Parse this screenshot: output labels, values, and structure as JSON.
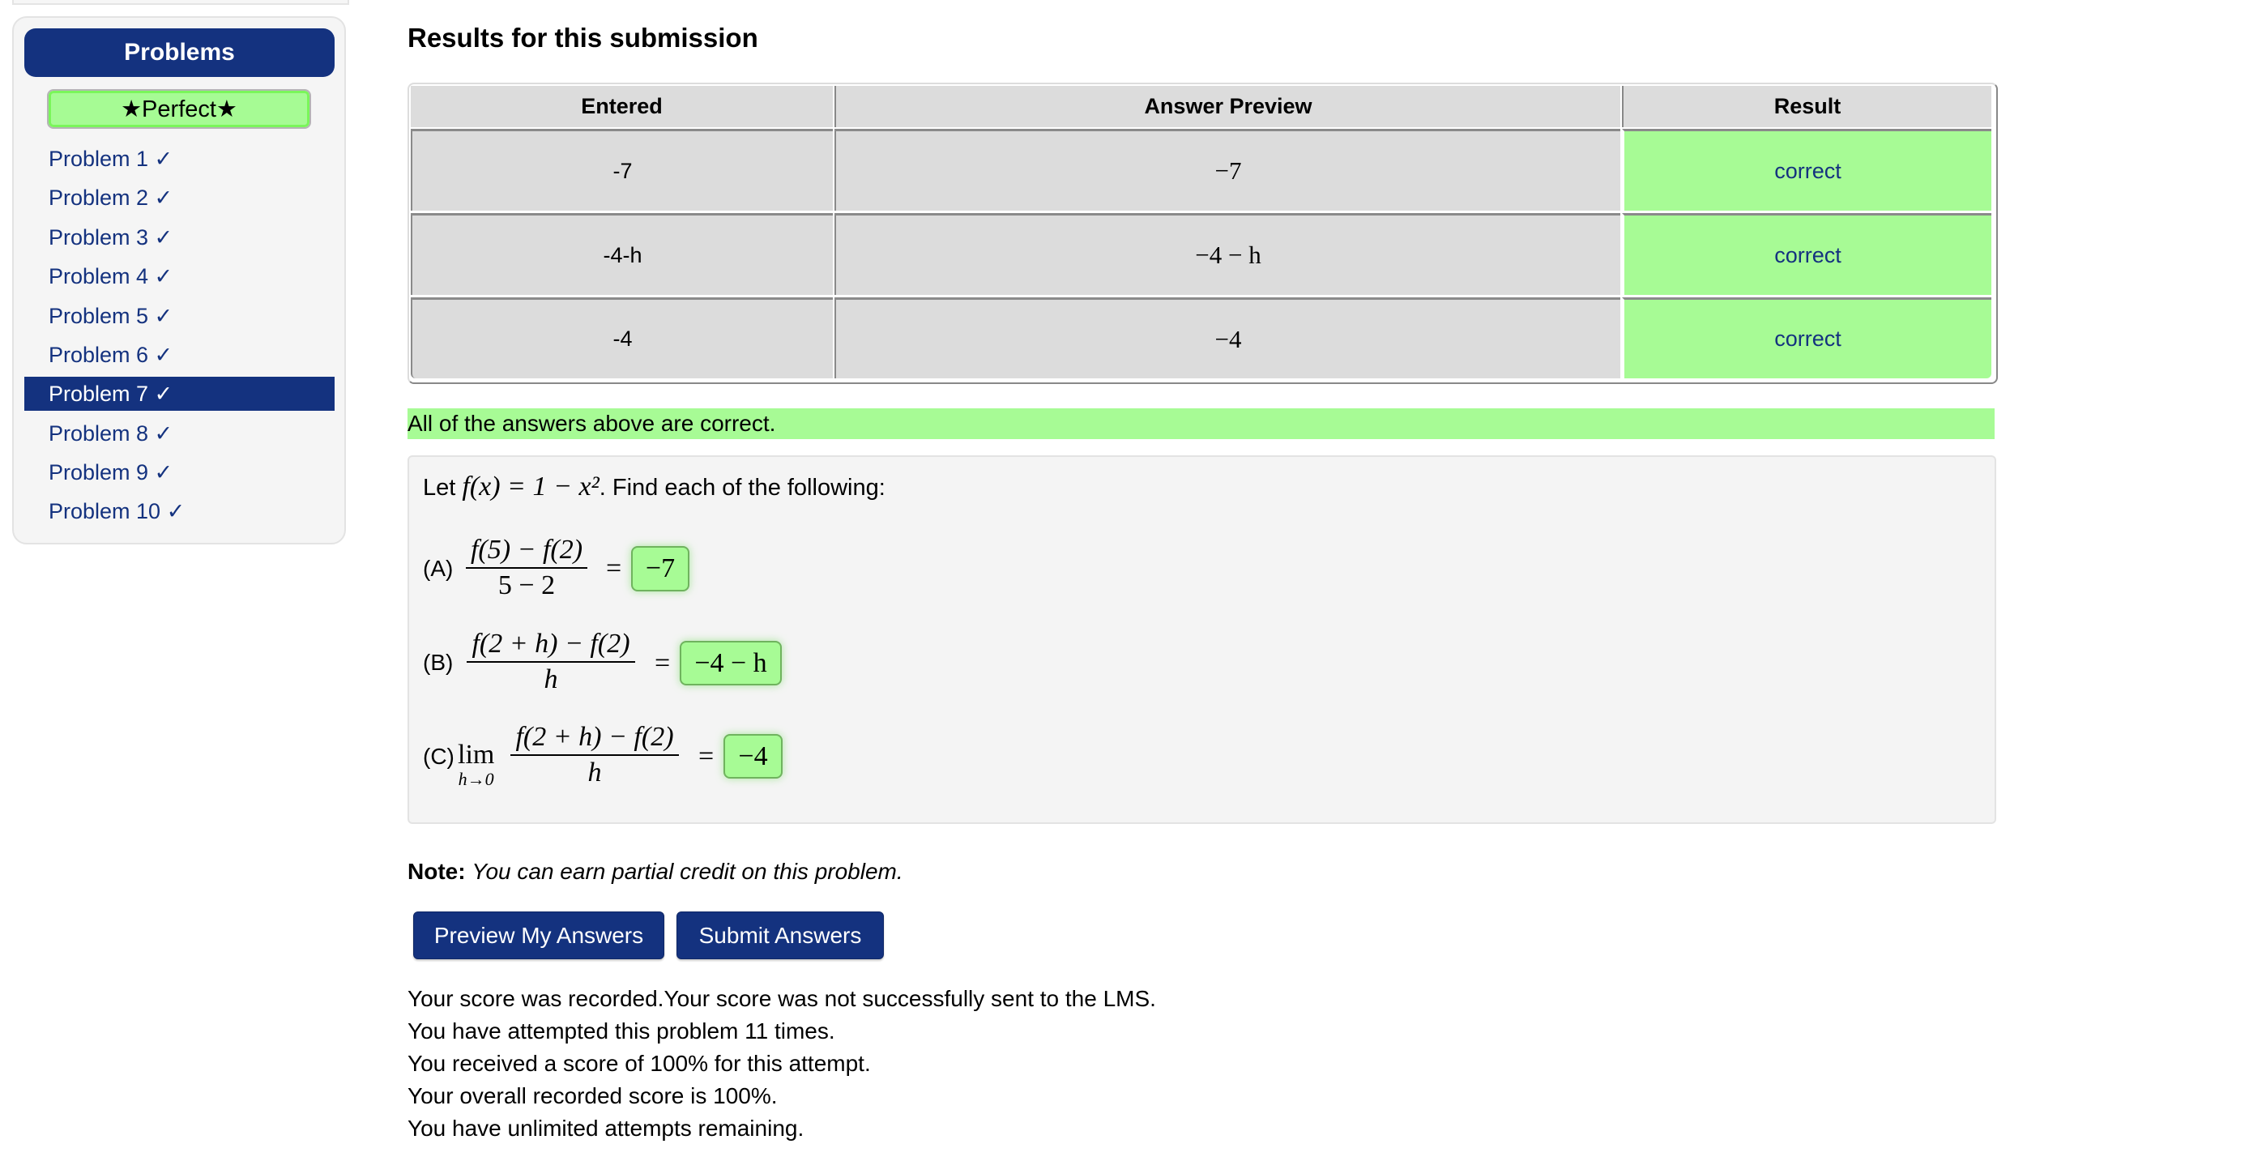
{
  "sidebar": {
    "title": "Problems",
    "status_badge": "★Perfect★",
    "items": [
      {
        "label": "Problem 1 ✓",
        "active": false
      },
      {
        "label": "Problem 2 ✓",
        "active": false
      },
      {
        "label": "Problem 3 ✓",
        "active": false
      },
      {
        "label": "Problem 4 ✓",
        "active": false
      },
      {
        "label": "Problem 5 ✓",
        "active": false
      },
      {
        "label": "Problem 6 ✓",
        "active": false
      },
      {
        "label": "Problem 7 ✓",
        "active": true
      },
      {
        "label": "Problem 8 ✓",
        "active": false
      },
      {
        "label": "Problem 9 ✓",
        "active": false
      },
      {
        "label": "Problem 10 ✓",
        "active": false
      }
    ]
  },
  "results": {
    "heading": "Results for this submission",
    "columns": [
      "Entered",
      "Answer Preview",
      "Result"
    ],
    "rows": [
      {
        "entered": "-7",
        "preview": "−7",
        "result": "correct"
      },
      {
        "entered": "-4-h",
        "preview": "−4 − h",
        "result": "correct"
      },
      {
        "entered": "-4",
        "preview": "−4",
        "result": "correct"
      }
    ],
    "summary": "All of the answers above are correct."
  },
  "problem": {
    "intro_prefix": "Let ",
    "intro_math": "f(x) = 1 − x²",
    "intro_suffix": ". Find each of the following:",
    "parts": [
      {
        "label": "(A)",
        "numerator": "f(5) − f(2)",
        "denominator": "5 − 2",
        "limit": null,
        "answer": "−7"
      },
      {
        "label": "(B)",
        "numerator": "f(2 + h) − f(2)",
        "denominator": "h",
        "limit": null,
        "answer": "−4 − h"
      },
      {
        "label": "(C)",
        "numerator": "f(2 + h) − f(2)",
        "denominator": "h",
        "limit": {
          "op": "lim",
          "sub": "h→0"
        },
        "answer": "−4"
      }
    ],
    "equals": "="
  },
  "note": {
    "label": "Note:",
    "text": "You can earn partial credit on this problem."
  },
  "buttons": {
    "preview": "Preview My Answers",
    "submit": "Submit Answers"
  },
  "score_messages": [
    "Your score was recorded.Your score was not successfully sent to the LMS.",
    "You have attempted this problem 11 times.",
    "You received a score of 100% for this attempt.",
    "Your overall recorded score is 100%.",
    "You have unlimited attempts remaining."
  ],
  "colors": {
    "brand_blue": "#14327f",
    "correct_green": "#a7fb95",
    "table_gray": "#dcdcdc"
  }
}
